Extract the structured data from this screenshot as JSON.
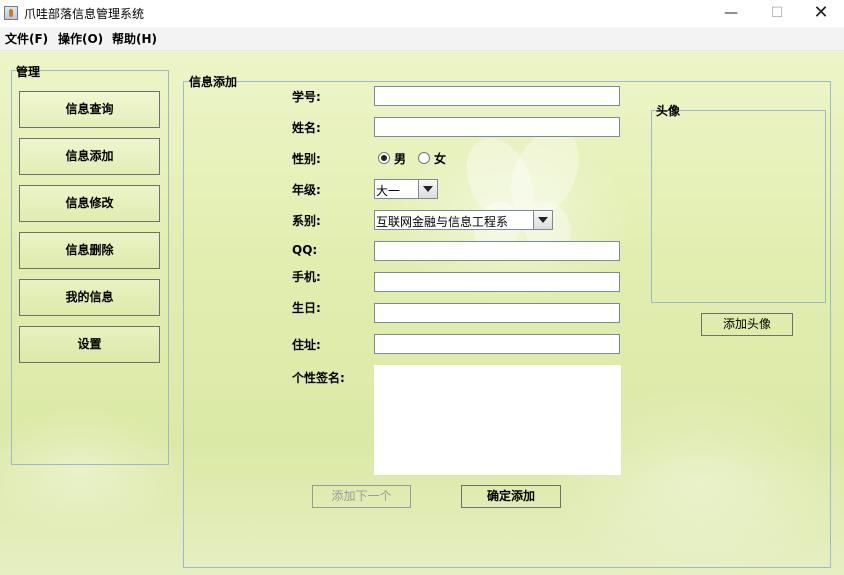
{
  "window": {
    "title": "爪哇部落信息管理系统",
    "minimize": "—",
    "maximize": "☐",
    "close": "✕"
  },
  "menu": {
    "file": "文件(F)",
    "operate": "操作(O)",
    "help": "帮助(H)"
  },
  "sidebar": {
    "title": "管理",
    "items": [
      {
        "label": "信息查询"
      },
      {
        "label": "信息添加"
      },
      {
        "label": "信息修改"
      },
      {
        "label": "信息删除"
      },
      {
        "label": "我的信息"
      },
      {
        "label": "设置"
      }
    ]
  },
  "form": {
    "title": "信息添加",
    "fields": {
      "student_id": {
        "label": "学号:",
        "value": ""
      },
      "name": {
        "label": "姓名:",
        "value": ""
      },
      "gender": {
        "label": "性别:",
        "options": [
          "男",
          "女"
        ],
        "selected": "男"
      },
      "grade": {
        "label": "年级:",
        "value": "大一"
      },
      "department": {
        "label": "系别:",
        "value": "互联网金融与信息工程系"
      },
      "qq": {
        "label": "QQ:",
        "value": ""
      },
      "phone": {
        "label": "手机:",
        "value": ""
      },
      "birthday": {
        "label": "生日:",
        "value": ""
      },
      "address": {
        "label": "住址:",
        "value": ""
      },
      "signature": {
        "label": "个性签名:",
        "value": ""
      }
    },
    "avatar": {
      "title": "头像",
      "add_button": "添加头像"
    },
    "buttons": {
      "next": "添加下一个",
      "confirm": "确定添加"
    }
  },
  "colors": {
    "background": "#e2eeb0",
    "border": "#9fb7c8",
    "disabled_text": "#9a9a9a"
  }
}
